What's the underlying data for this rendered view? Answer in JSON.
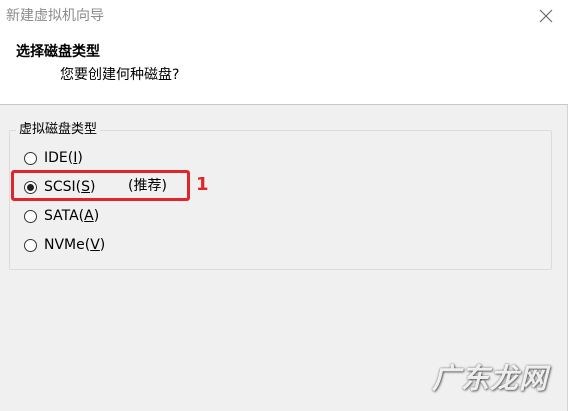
{
  "window": {
    "title": "新建虚拟机向导"
  },
  "header": {
    "title": "选择磁盘类型",
    "subtitle": "您要创建何种磁盘?"
  },
  "disk_type_group": {
    "legend": "虚拟磁盘类型",
    "options": [
      {
        "prefix": "IDE(",
        "key": "I",
        "suffix": ")",
        "checked": false
      },
      {
        "prefix": "SCSI(",
        "key": "S",
        "suffix": ")",
        "checked": true
      },
      {
        "prefix": "SATA(",
        "key": "A",
        "suffix": ")",
        "checked": false
      },
      {
        "prefix": "NVMe(",
        "key": "V",
        "suffix": ")",
        "checked": false
      }
    ],
    "recommended_note": "(推荐)"
  },
  "annotation": {
    "step_number": "1",
    "color": "#e0262b"
  },
  "watermark": {
    "text": "广东龙网"
  },
  "icons": {
    "close": "close-icon"
  }
}
